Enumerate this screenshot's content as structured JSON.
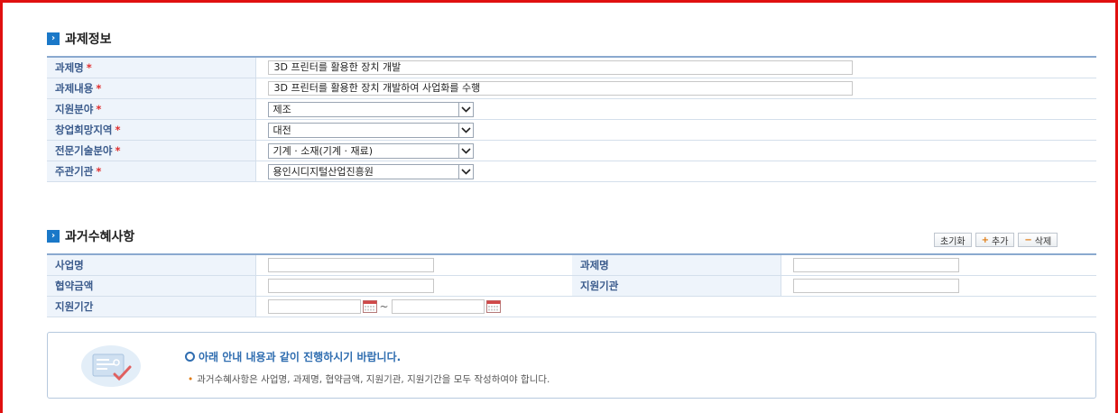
{
  "section1": {
    "title": "과제정보"
  },
  "project_form": {
    "rows": [
      {
        "label": "과제명",
        "type": "text",
        "value": "3D 프린터를 활용한 장치 개발"
      },
      {
        "label": "과제내용",
        "type": "text",
        "value": "3D 프린터를 활용한 장치 개발하여 사업화를 수행"
      },
      {
        "label": "지원분야",
        "type": "select",
        "value": "제조"
      },
      {
        "label": "창업희망지역",
        "type": "select",
        "value": "대전"
      },
      {
        "label": "전문기술분야",
        "type": "select",
        "value": "기계 · 소재(기계 · 재료)"
      },
      {
        "label": "주관기관",
        "type": "select",
        "value": "용인시디지털산업진흥원"
      }
    ]
  },
  "section2": {
    "title": "과거수혜사항"
  },
  "buttons": {
    "reset": "초기화",
    "add": "추가",
    "delete": "삭제"
  },
  "past_form": {
    "business_name": "사업명",
    "project_name": "과제명",
    "contract_amount": "협약금액",
    "support_agency": "지원기관",
    "support_period": "지원기간",
    "tilde": "~"
  },
  "notice": {
    "title": "아래 안내 내용과 같이 진행하시기 바랍니다.",
    "body": "과거수혜사항은 사업명, 과제명, 협약금액, 지원기관, 지원기간을 모두 작성하여야 합니다."
  },
  "colors": {
    "accent": "#1a78c8",
    "label_bg": "#eef4fb",
    "required": "#e03030",
    "frame": "#e01010"
  }
}
